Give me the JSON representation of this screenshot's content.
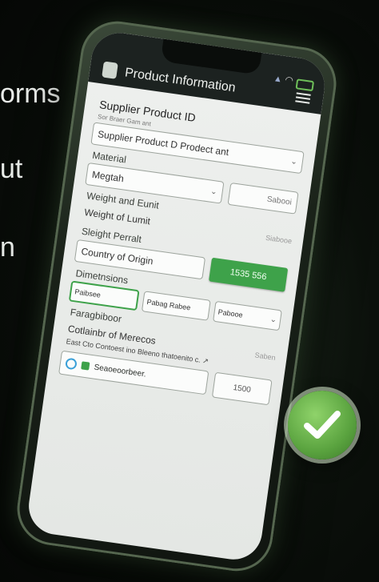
{
  "side_text": [
    "orms",
    "ut",
    "n"
  ],
  "header": {
    "title": "Product Information"
  },
  "form": {
    "supplier_product_id_label": "Supplier Product ID",
    "supplier_product_id_hint": "Sor Braer Gam ant",
    "supplier_product_id_value": "Supplier Product D Prodect ant",
    "material_label": "Material",
    "material_value": "Megtah",
    "material_number": "Sabooi",
    "weight_label": "Weight and Eunit",
    "weight_value": "Weight of Lumit",
    "weight_number": "Siabooe",
    "sleight_label": "Sleight Perralt",
    "country_value": "Country of Origin",
    "country_button": "1535 556",
    "dimensions_label": "Dimetnsions",
    "dim_1": "Paibsee",
    "dim_2": "Pabag Rabee",
    "dim_3": "Pabooe",
    "faraghber_label": "Faragbiboor",
    "container_value": "Cotlainbr of Merecos",
    "container_number": "Saben",
    "east_label": "East Cto Contoest ino Bleeno thatoenito c. ↗",
    "search_value": "Seaoeoorbeer.",
    "footer_number": "1500"
  },
  "colors": {
    "accent": "#3ea24a",
    "background": "#0b100b"
  }
}
